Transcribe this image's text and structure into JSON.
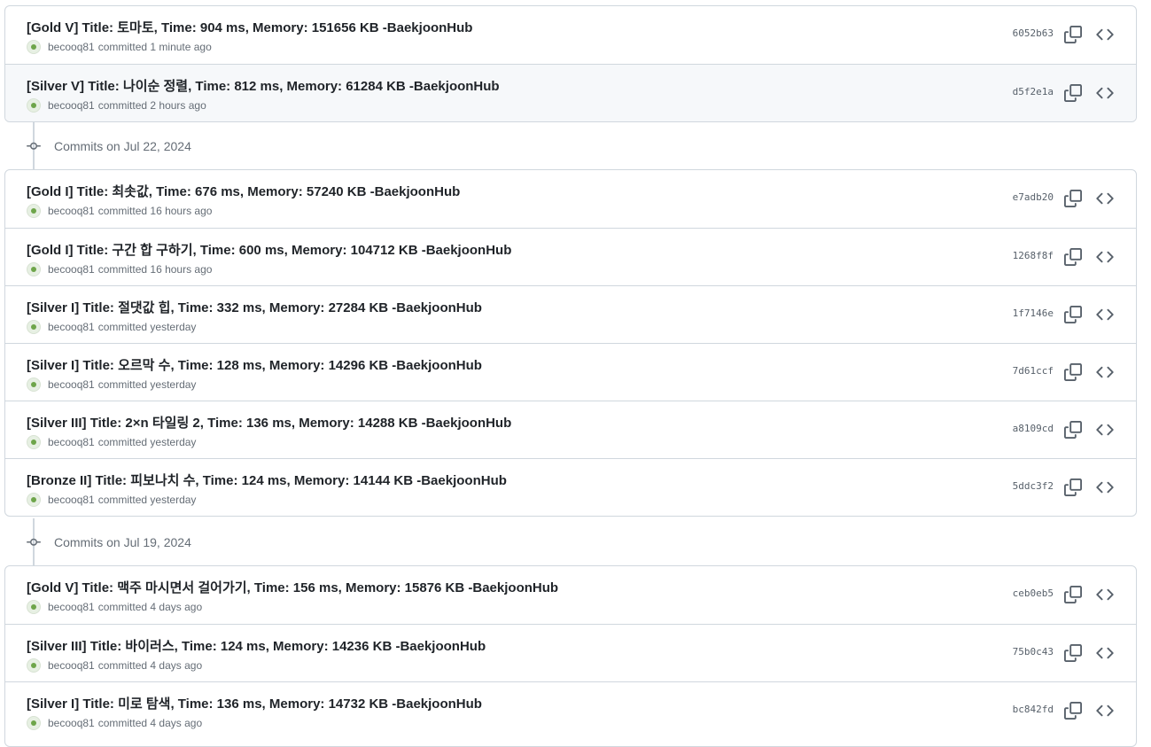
{
  "groups": [
    {
      "header": "",
      "commits": [
        {
          "title": "[Gold V] Title: 토마토, Time: 904 ms, Memory: 151656 KB -BaekjoonHub",
          "author": "becooq81",
          "time": "committed 1 minute ago",
          "sha": "6052b63"
        },
        {
          "title": "[Silver V] Title: 나이순 정렬, Time: 812 ms, Memory: 61284 KB -BaekjoonHub",
          "author": "becooq81",
          "time": "committed 2 hours ago",
          "sha": "d5f2e1a"
        }
      ]
    },
    {
      "header": "Commits on Jul 22, 2024",
      "commits": [
        {
          "title": "[Gold I] Title: 최솟값, Time: 676 ms, Memory: 57240 KB -BaekjoonHub",
          "author": "becooq81",
          "time": "committed 16 hours ago",
          "sha": "e7adb20"
        },
        {
          "title": "[Gold I] Title: 구간 합 구하기, Time: 600 ms, Memory: 104712 KB -BaekjoonHub",
          "author": "becooq81",
          "time": "committed 16 hours ago",
          "sha": "1268f8f"
        },
        {
          "title": "[Silver I] Title: 절댓값 힙, Time: 332 ms, Memory: 27284 KB -BaekjoonHub",
          "author": "becooq81",
          "time": "committed yesterday",
          "sha": "1f7146e"
        },
        {
          "title": "[Silver I] Title: 오르막 수, Time: 128 ms, Memory: 14296 KB -BaekjoonHub",
          "author": "becooq81",
          "time": "committed yesterday",
          "sha": "7d61ccf"
        },
        {
          "title": "[Silver III] Title: 2×n 타일링 2, Time: 136 ms, Memory: 14288 KB -BaekjoonHub",
          "author": "becooq81",
          "time": "committed yesterday",
          "sha": "a8109cd"
        },
        {
          "title": "[Bronze II] Title: 피보나치 수, Time: 124 ms, Memory: 14144 KB -BaekjoonHub",
          "author": "becooq81",
          "time": "committed yesterday",
          "sha": "5ddc3f2"
        }
      ]
    },
    {
      "header": "Commits on Jul 19, 2024",
      "commits": [
        {
          "title": "[Gold V] Title: 맥주 마시면서 걸어가기, Time: 156 ms, Memory: 15876 KB -BaekjoonHub",
          "author": "becooq81",
          "time": "committed 4 days ago",
          "sha": "ceb0eb5"
        },
        {
          "title": "[Silver III] Title: 바이러스, Time: 124 ms, Memory: 14236 KB -BaekjoonHub",
          "author": "becooq81",
          "time": "committed 4 days ago",
          "sha": "75b0c43"
        },
        {
          "title": "[Silver I] Title: 미로 탐색, Time: 136 ms, Memory: 14732 KB -BaekjoonHub",
          "author": "becooq81",
          "time": "committed 4 days ago",
          "sha": "bc842fd"
        }
      ]
    }
  ],
  "icons": {
    "copy": "copy-icon",
    "browse": "code-icon",
    "commit": "git-commit-icon"
  }
}
